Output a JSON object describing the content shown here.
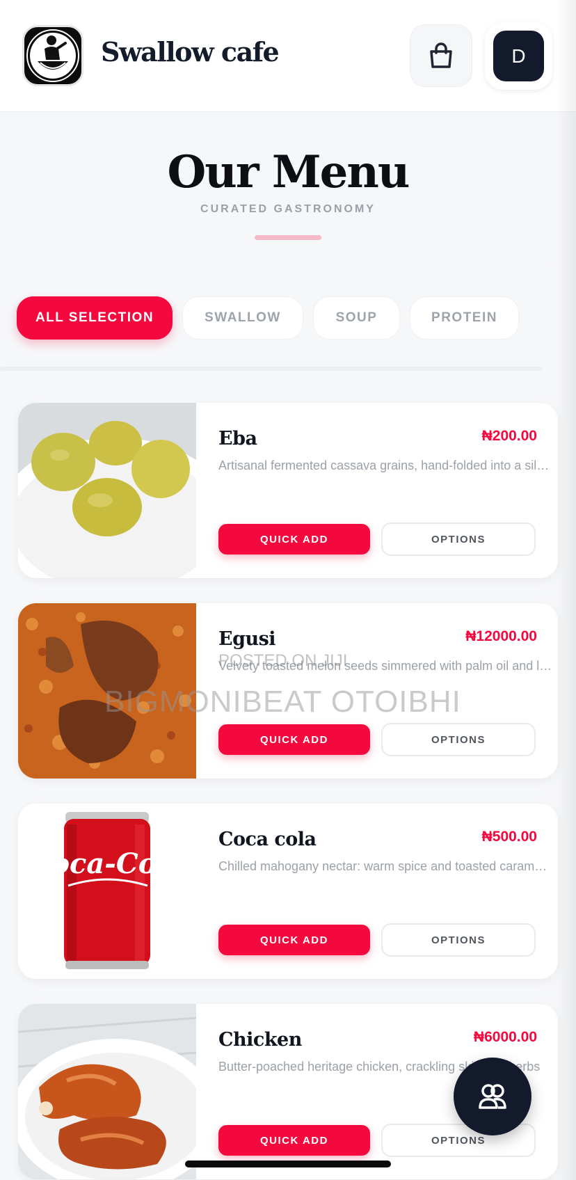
{
  "header": {
    "brand": "Swallow cafe",
    "avatar_initial": "D",
    "icons": [
      "logo",
      "shopping-bag-icon",
      "avatar"
    ]
  },
  "hero": {
    "title": "Our Menu",
    "subtitle": "CURATED GASTRONOMY"
  },
  "filters": [
    {
      "label": "ALL SELECTION",
      "active": true
    },
    {
      "label": "SWALLOW",
      "active": false
    },
    {
      "label": "SOUP",
      "active": false
    },
    {
      "label": "PROTEIN",
      "active": false
    }
  ],
  "menu": [
    {
      "name": "Eba",
      "price": "₦200.00",
      "description": "Artisanal fermented cassava grains, hand-folded into a silky, golden swallow",
      "quick_add": "QUICK ADD",
      "options": "OPTIONS"
    },
    {
      "name": "Egusi",
      "price": "₦12000.00",
      "description": "Velvety toasted melon seeds simmered with palm oil and leafy greens",
      "quick_add": "QUICK ADD",
      "options": "OPTIONS"
    },
    {
      "name": "Coca cola",
      "price": "₦500.00",
      "description": "Chilled mahogany nectar: warm spice and toasted caramel notes",
      "quick_add": "QUICK ADD",
      "options": "OPTIONS"
    },
    {
      "name": "Chicken",
      "price": "₦6000.00",
      "description": "Butter-poached heritage chicken, crackling skin and herbs",
      "quick_add": "QUICK ADD",
      "options": "OPTIONS"
    }
  ],
  "watermark": {
    "line1": "POSTED ON JIJI",
    "line2": "BIGMONIBEAT OTOIBHI"
  },
  "colors": {
    "accent": "#f5083d",
    "dark": "#131a2b",
    "background": "#f6f7f9"
  }
}
